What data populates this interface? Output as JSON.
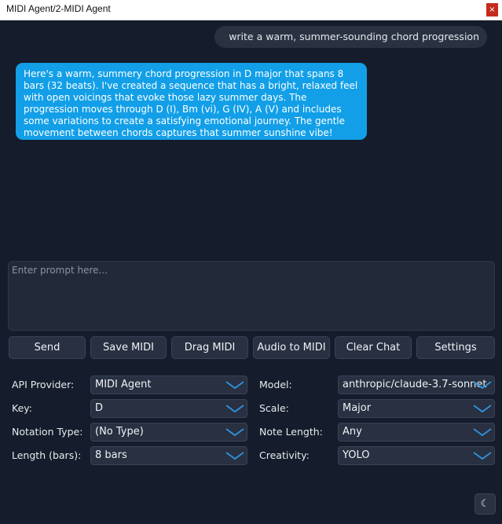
{
  "window": {
    "title": "MIDI Agent/2-MIDI Agent",
    "close_glyph": "×"
  },
  "chat": {
    "user_message": "write a warm, summer-sounding chord progression",
    "ai_message": "Here's a warm, summery chord progression in D major that spans 8 bars (32 beats). I've created a sequence that has a bright, relaxed feel with open voicings that evoke those lazy summer days. The progression moves through D (I), Bm (vi), G (IV), A (V) and includes some variations to create a satisfying emotional journey. The gentle movement between chords captures that summer sunshine vibe!"
  },
  "prompt": {
    "placeholder": "Enter prompt here...",
    "value": ""
  },
  "buttons": {
    "send": "Send",
    "save_midi": "Save MIDI",
    "drag_midi": "Drag MIDI",
    "audio_to_midi": "Audio to MIDI",
    "clear_chat": "Clear Chat",
    "settings": "Settings"
  },
  "settings": {
    "api_provider": {
      "label": "API Provider:",
      "value": "MIDI Agent"
    },
    "model": {
      "label": "Model:",
      "value": "anthropic/claude-3.7-sonnet"
    },
    "key": {
      "label": "Key:",
      "value": "D"
    },
    "scale": {
      "label": "Scale:",
      "value": "Major"
    },
    "notation_type": {
      "label": "Notation Type:",
      "value": "(No Type)"
    },
    "note_length": {
      "label": "Note Length:",
      "value": "Any"
    },
    "length_bars": {
      "label": "Length (bars):",
      "value": "8 bars"
    },
    "creativity": {
      "label": "Creativity:",
      "value": "YOLO"
    }
  },
  "theme_toggle": {
    "glyph": "☾",
    "icon": "moon-icon"
  },
  "colors": {
    "background": "#151c2b",
    "ai_bubble": "#129fe8",
    "user_bubble": "#2a3242",
    "control": "#283041",
    "chevron": "#2f8fd8",
    "close_button": "#c42b1c"
  }
}
